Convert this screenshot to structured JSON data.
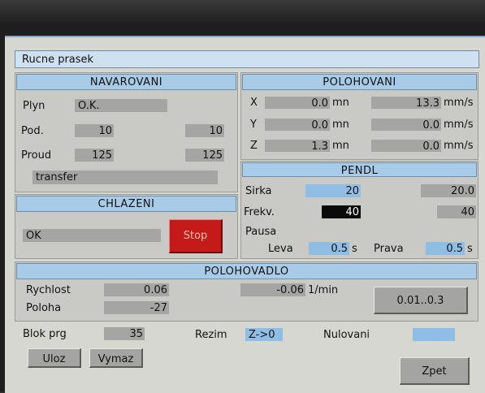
{
  "window": {
    "title": "Rucne prasek"
  },
  "navarovani": {
    "heading": "NAVAROVANI",
    "plyn_label": "Plyn",
    "plyn_value": "O.K.",
    "pod_label": "Pod.",
    "pod_value": "10",
    "pod_value2": "10",
    "proud_label": "Proud",
    "proud_value": "125",
    "proud_value2": "125",
    "mode_value": "transfer"
  },
  "polohovani": {
    "heading": "POLOHOVANI",
    "axes": [
      {
        "label": "X",
        "pos": "0.0",
        "pos_unit": "mn",
        "speed": "13.3",
        "speed_unit": "mm/s"
      },
      {
        "label": "Y",
        "pos": "0.0",
        "pos_unit": "mn",
        "speed": "0.0",
        "speed_unit": "mm/s"
      },
      {
        "label": "Z",
        "pos": "1.3",
        "pos_unit": "mn",
        "speed": "0.0",
        "speed_unit": "mm/s"
      }
    ]
  },
  "chlazeni": {
    "heading": "CHLAZENI",
    "status": "OK",
    "stop_label": "Stop"
  },
  "pendl": {
    "heading": "PENDL",
    "sirka_label": "Sirka",
    "sirka_value": "20",
    "sirka_value2": "20.0",
    "frekv_label": "Frekv.",
    "frekv_value": "40",
    "frekv_value2": "40",
    "pausa_label": "Pausa",
    "leva_label": "Leva",
    "leva_value": "0.5",
    "leva_unit": "s",
    "prava_label": "Prava",
    "prava_value": "0.5",
    "prava_unit": "s"
  },
  "polohovadlo": {
    "heading": "POLOHOVADLO",
    "rychlost_label": "Rychlost",
    "rychlost_value": "0.06",
    "rychlost_value2": "-0.06",
    "rychlost_unit": "1/min",
    "poloha_label": "Poloha",
    "poloha_value": "-27",
    "range_label": "0.01..0.3"
  },
  "footer": {
    "blok_label": "Blok prg",
    "blok_value": "35",
    "rezim_label": "Rezim",
    "rezim_value": "Z->0",
    "nulovani_label": "Nulovani",
    "nulovani_value": "",
    "uloz_label": "Uloz",
    "vymaz_label": "Vymaz",
    "zpet_label": "Zpet"
  }
}
